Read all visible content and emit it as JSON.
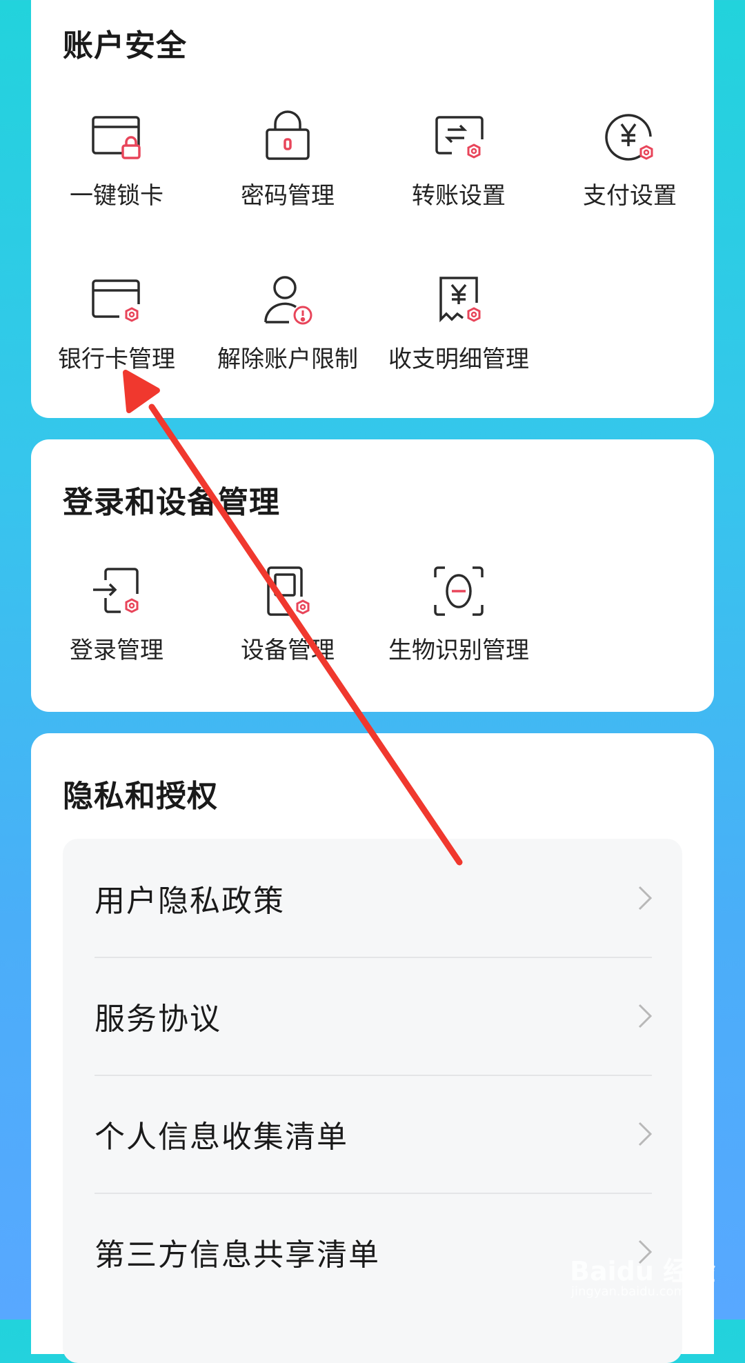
{
  "account_security": {
    "title": "账户安全",
    "items": [
      {
        "label": "一键锁卡",
        "icon": "card-lock-icon"
      },
      {
        "label": "密码管理",
        "icon": "padlock-icon"
      },
      {
        "label": "转账设置",
        "icon": "transfer-icon"
      },
      {
        "label": "支付设置",
        "icon": "yen-payment-icon"
      },
      {
        "label": "银行卡管理",
        "icon": "bank-card-icon"
      },
      {
        "label": "解除账户限制",
        "icon": "user-alert-icon"
      },
      {
        "label": "收支明细管理",
        "icon": "receipt-yen-icon"
      }
    ]
  },
  "login_devices": {
    "title": "登录和设备管理",
    "items": [
      {
        "label": "登录管理",
        "icon": "login-icon"
      },
      {
        "label": "设备管理",
        "icon": "device-icon"
      },
      {
        "label": "生物识别管理",
        "icon": "face-id-icon"
      }
    ]
  },
  "privacy": {
    "title": "隐私和授权",
    "rows": [
      {
        "label": "用户隐私政策"
      },
      {
        "label": "服务协议"
      },
      {
        "label": "个人信息收集清单"
      },
      {
        "label": "第三方信息共享清单"
      }
    ]
  },
  "watermark": {
    "main": "Baidu 经验",
    "sub": "jingyan.baidu.com"
  },
  "colors": {
    "accent_red": "#e8455a",
    "annotation_red": "#f0382e",
    "icon_stroke": "#2b2b2b"
  }
}
